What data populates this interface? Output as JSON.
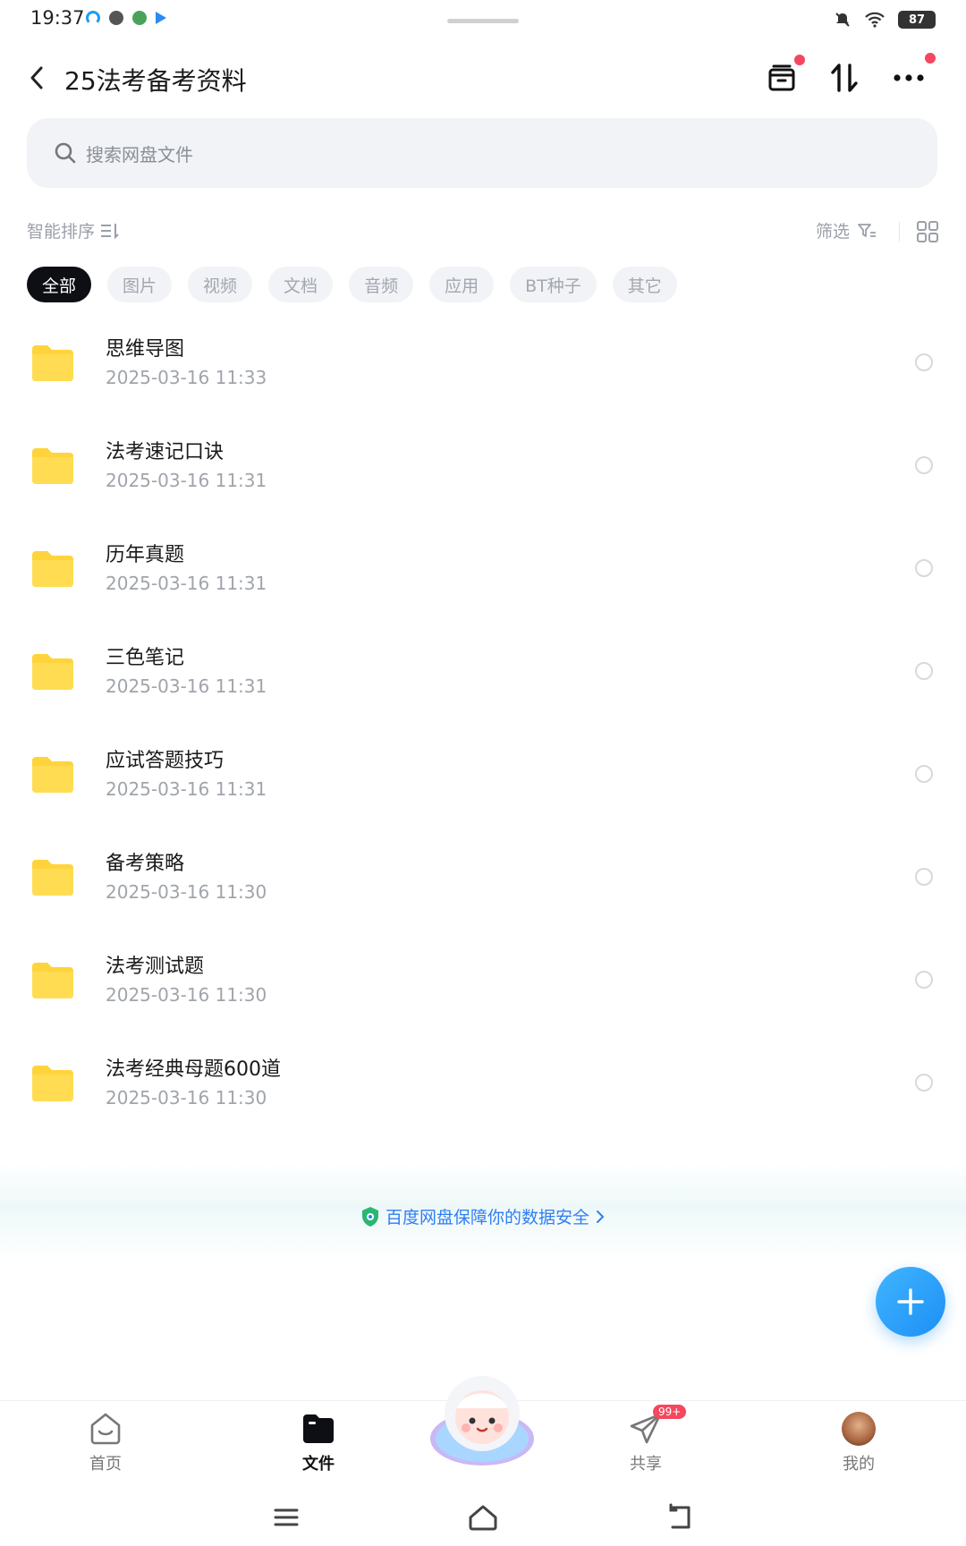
{
  "status_bar": {
    "time": "19:37",
    "battery": "87"
  },
  "header": {
    "title": "25法考备考资料"
  },
  "search": {
    "placeholder": "搜索网盘文件"
  },
  "sort": {
    "label": "智能排序",
    "filter_label": "筛选"
  },
  "chips": [
    "全部",
    "图片",
    "视频",
    "文档",
    "音频",
    "应用",
    "BT种子",
    "其它"
  ],
  "files": [
    {
      "name": "思维导图",
      "date": "2025-03-16  11:33"
    },
    {
      "name": "法考速记口诀",
      "date": "2025-03-16  11:31"
    },
    {
      "name": "历年真题",
      "date": "2025-03-16  11:31"
    },
    {
      "name": "三色笔记",
      "date": "2025-03-16  11:31"
    },
    {
      "name": "应试答题技巧",
      "date": "2025-03-16  11:31"
    },
    {
      "name": "备考策略",
      "date": "2025-03-16  11:30"
    },
    {
      "name": "法考测试题",
      "date": "2025-03-16  11:30"
    },
    {
      "name": "法考经典母题600道",
      "date": "2025-03-16  11:30"
    }
  ],
  "security": {
    "text": "百度网盘保障你的数据安全"
  },
  "bottom_nav": {
    "home": "首页",
    "files": "文件",
    "share": "共享",
    "share_badge": "99+",
    "mine": "我的"
  },
  "colors": {
    "accent": "#2f7ef5",
    "folder": "#ffd43b",
    "red_dot": "#f5475f"
  }
}
